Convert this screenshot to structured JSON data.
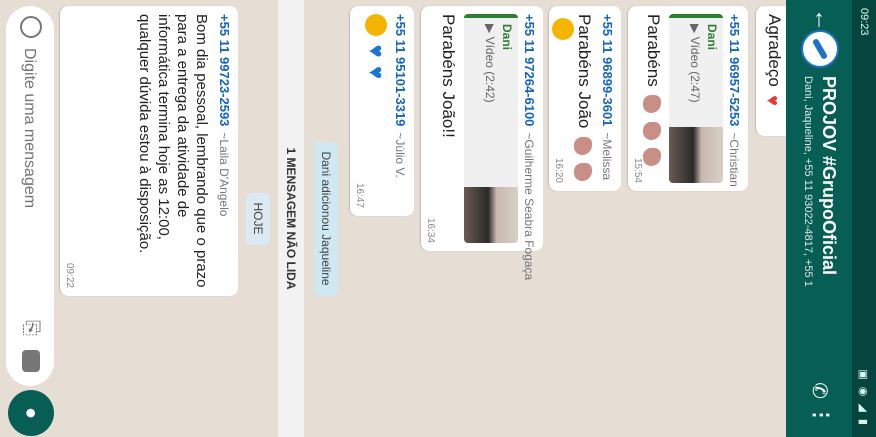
{
  "status_bar": {
    "time": "09:23",
    "icons": "▣ ◉ ◢ ▮"
  },
  "header": {
    "title": "PROJOV #GrupoOficial",
    "subtitle": "Dani, Jaqueline, +55 11 93022-4817, +55 1"
  },
  "messages": [
    {
      "text": "Agradeço"
    },
    {
      "sender": "+55 11 96957-5253",
      "name": "~Christian",
      "quote_name": "Dani",
      "quote_text": "Vídeo (2:47)",
      "text": "Parabéns",
      "time": "15:54"
    },
    {
      "sender": "+55 11 96899-3601",
      "name": "~Melissa",
      "text": "Parabéns João",
      "time": "16:20"
    },
    {
      "sender": "+55 11 97264-6100",
      "name": "~Guilherme Seabra Fogaça",
      "quote_name": "Dani",
      "quote_text": "Vídeo (2:42)",
      "text": "Parabéns João!!",
      "time": "16:34"
    },
    {
      "sender": "+55 11 95101-3319",
      "name": "~Júlio V.",
      "time": "16:47"
    },
    {
      "sender": "+55 11 99723-2593",
      "name": "~Laila D'Angelo",
      "text": "Bom dia pessoal, lembrando que o prazo para a entrega da atividade de informática termina hoje as 12:00, qualquer dúvida estou à disposição.",
      "time": "09:22"
    }
  ],
  "system": {
    "added": "Dani adicionou Jaqueline",
    "unread": "1 MENSAGEM NÃO LIDA",
    "today": "HOJE"
  },
  "input": {
    "placeholder": "Digite uma mensagem"
  },
  "colors": {
    "header": "#075e54",
    "status": "#06453f",
    "chat_bg": "#e6ddd4",
    "sender": "#1565c0",
    "quote": "#2e7d32"
  },
  "icons": [
    "back-arrow-icon",
    "group-avatar",
    "add-call-icon",
    "more-vert-icon",
    "emoji-icon",
    "attach-icon",
    "camera-icon",
    "mic-icon"
  ]
}
